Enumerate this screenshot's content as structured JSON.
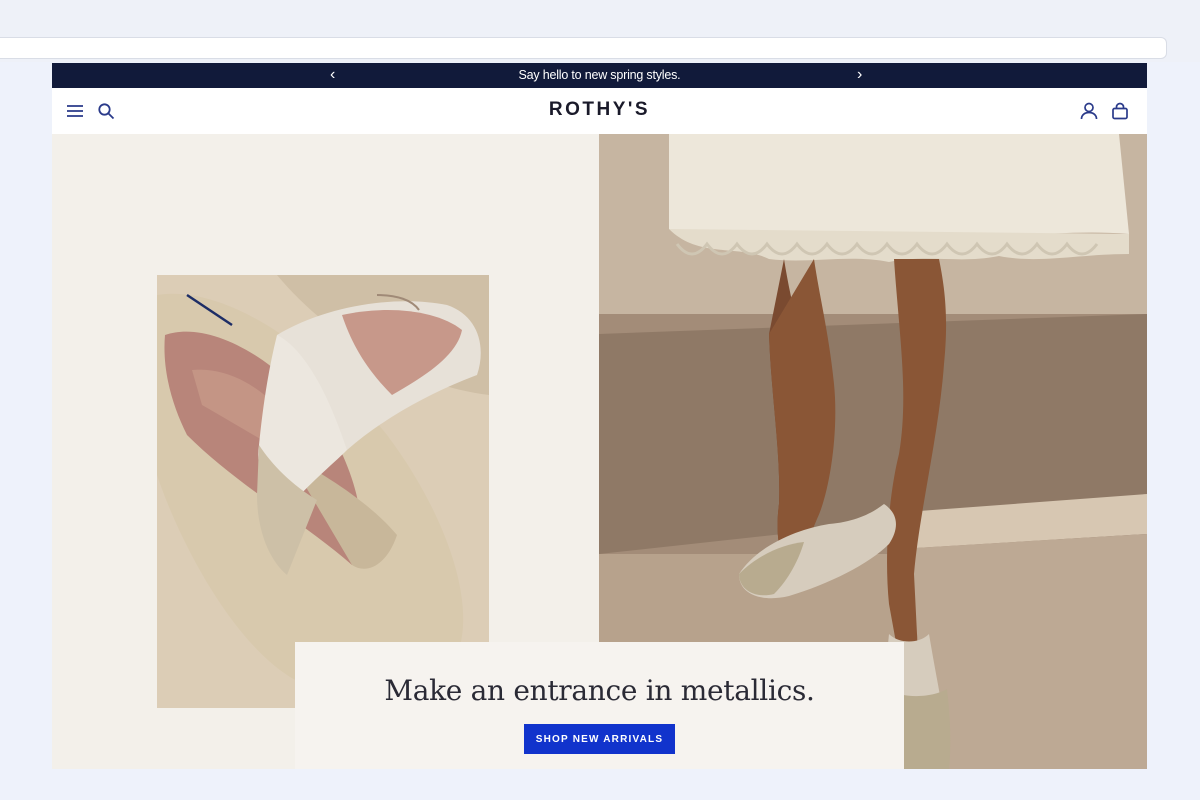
{
  "announcement": {
    "message": "Say hello to new spring styles.",
    "prev_icon": "chevron-left-icon",
    "next_icon": "chevron-right-icon"
  },
  "header": {
    "logo": "ROTHY'S",
    "left_icons": [
      "menu-icon",
      "search-icon"
    ],
    "right_icons": [
      "account-icon",
      "bag-icon"
    ]
  },
  "hero": {
    "headline": "Make an entrance in metallics.",
    "cta_label": "SHOP NEW ARRIVALS",
    "left_image": "knit pointed flats close-up",
    "right_image": "model wearing flats with ruffled dress"
  },
  "colors": {
    "announcement_bg": "#111a3a",
    "cta_bg": "#1133cc",
    "left_panel_bg": "#f3f0ea",
    "caption_bg": "#f6f3ef"
  }
}
